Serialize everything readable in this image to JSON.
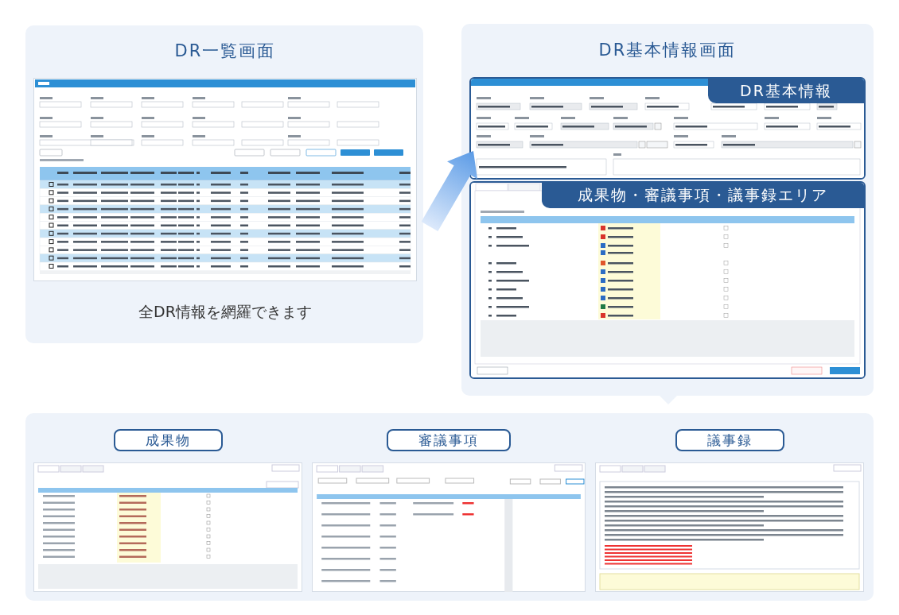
{
  "overview": {
    "title": "DR一覧画面",
    "caption": "全DR情報を網羅できます"
  },
  "detail": {
    "title": "DR基本情報画面",
    "banners": [
      "DR基本情報",
      "成果物・審議事項・議事録エリア"
    ]
  },
  "sections": [
    {
      "label": "成果物",
      "kind": "deliverables"
    },
    {
      "label": "審議事項",
      "kind": "agenda"
    },
    {
      "label": "議事録",
      "kind": "minutes"
    }
  ]
}
